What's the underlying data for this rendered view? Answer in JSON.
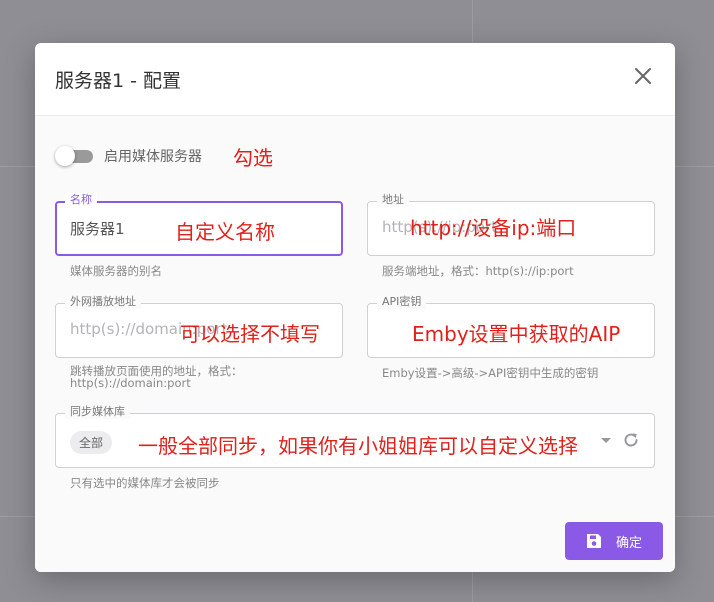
{
  "dialog": {
    "title": "服务器1 - 配置",
    "confirm_label": "确定"
  },
  "toggle": {
    "label": "启用媒体服务器",
    "enabled": false
  },
  "fields": {
    "name": {
      "legend": "名称",
      "value": "服务器1",
      "hint": "媒体服务器的别名"
    },
    "address": {
      "legend": "地址",
      "placeholder": "http(s)://ip:port",
      "hint": "服务端地址，格式：http(s)://ip:port"
    },
    "external": {
      "legend": "外网播放地址",
      "placeholder": "http(s)://domain:port",
      "hint_line1": "跳转播放页面使用的地址，格式：",
      "hint_line2": "http(s)://domain:port"
    },
    "api_key": {
      "legend": "API密钥",
      "placeholder": "",
      "hint": "Emby设置->高级->API密钥中生成的密钥"
    },
    "sync_libraries": {
      "legend": "同步媒体库",
      "chip": "全部",
      "hint": "只有选中的媒体库才会被同步"
    }
  },
  "annotations": {
    "toggle": "勾选",
    "name": "自定义名称",
    "address": "http://设备ip:端口",
    "external": "可以选择不填写",
    "api_key": "Emby设置中获取的AIP",
    "sync": "一般全部同步，如果你有小姐姐库可以自定义选择"
  },
  "colors": {
    "accent": "#8a5ae6",
    "annotation": "#e0211b"
  },
  "icons": {
    "close": "close-icon",
    "refresh": "refresh-icon",
    "save": "save-icon",
    "dropdown": "chevron-down-icon"
  }
}
